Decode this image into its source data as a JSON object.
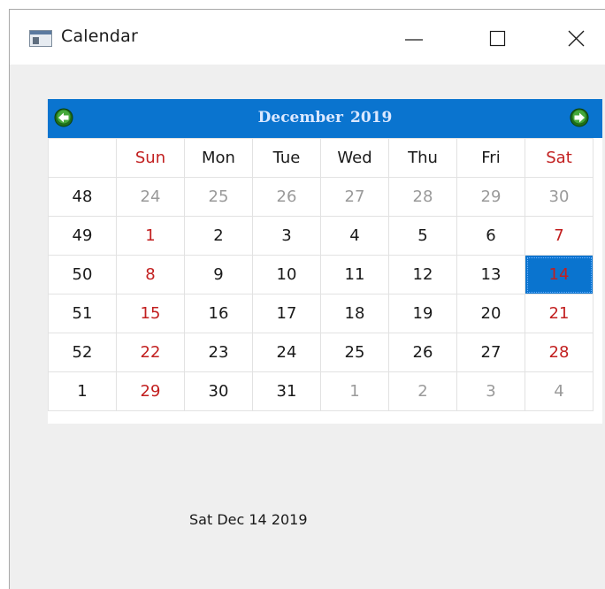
{
  "window": {
    "title": "Calendar",
    "icon": "app-window-icon",
    "controls": [
      "minimize-icon",
      "maximize-icon",
      "close-icon"
    ]
  },
  "calendar": {
    "month": "December",
    "year": "2019",
    "prev_icon": "arrow-left-icon",
    "next_icon": "arrow-right-icon",
    "header_color": "#0a74cf",
    "selected_color": "#0a74cf",
    "weekend_color": "#c21f1f",
    "week_header": "",
    "day_headers": [
      "Sun",
      "Mon",
      "Tue",
      "Wed",
      "Thu",
      "Fri",
      "Sat"
    ],
    "weeks": [
      {
        "week": "48",
        "days": [
          "24",
          "25",
          "26",
          "27",
          "28",
          "29",
          "30"
        ],
        "other": [
          true,
          true,
          true,
          true,
          true,
          true,
          true
        ]
      },
      {
        "week": "49",
        "days": [
          "1",
          "2",
          "3",
          "4",
          "5",
          "6",
          "7"
        ],
        "other": [
          false,
          false,
          false,
          false,
          false,
          false,
          false
        ]
      },
      {
        "week": "50",
        "days": [
          "8",
          "9",
          "10",
          "11",
          "12",
          "13",
          "14"
        ],
        "other": [
          false,
          false,
          false,
          false,
          false,
          false,
          false
        ]
      },
      {
        "week": "51",
        "days": [
          "15",
          "16",
          "17",
          "18",
          "19",
          "20",
          "21"
        ],
        "other": [
          false,
          false,
          false,
          false,
          false,
          false,
          false
        ]
      },
      {
        "week": "52",
        "days": [
          "22",
          "23",
          "24",
          "25",
          "26",
          "27",
          "28"
        ],
        "other": [
          false,
          false,
          false,
          false,
          false,
          false,
          false
        ]
      },
      {
        "week": "1",
        "days": [
          "29",
          "30",
          "31",
          "1",
          "2",
          "3",
          "4"
        ],
        "other": [
          false,
          false,
          false,
          true,
          true,
          true,
          true
        ]
      }
    ],
    "selected_date": "14"
  },
  "status": {
    "text": "Sat Dec 14 2019"
  }
}
